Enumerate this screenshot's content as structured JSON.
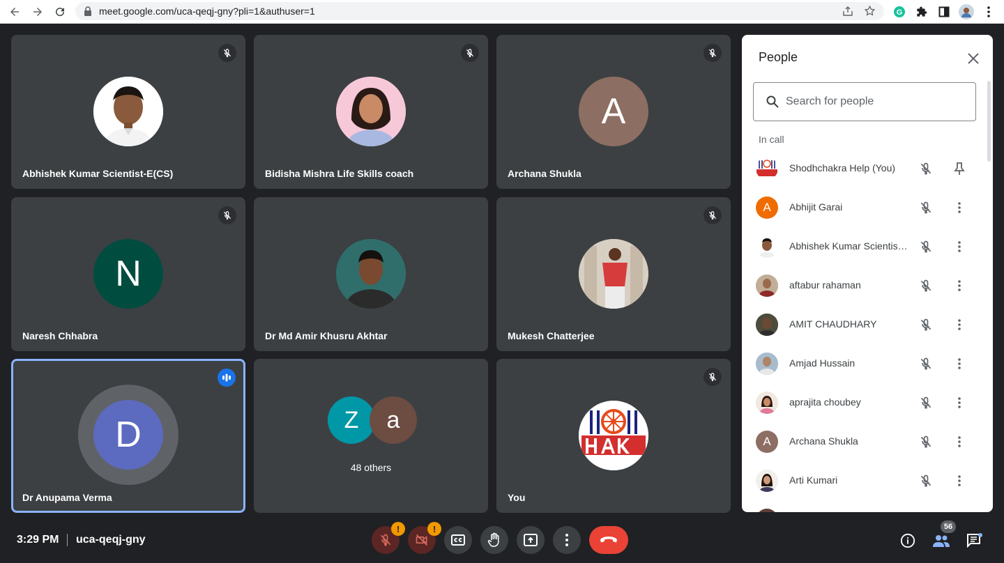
{
  "browser": {
    "url": "meet.google.com/uca-qeqj-gny?pli=1&authuser=1",
    "icons": [
      "back-icon",
      "forward-icon",
      "reload-icon",
      "lock-icon",
      "share-icon",
      "star-icon",
      "grammarly-icon",
      "extensions-icon",
      "sidepanel-icon",
      "profile-icon",
      "menu-icon"
    ]
  },
  "tiles": [
    {
      "name": "Abhishek Kumar Scientist-E(CS)",
      "avatar_type": "photo",
      "muted": true
    },
    {
      "name": "Bidisha Mishra Life Skills coach",
      "avatar_type": "photo",
      "muted": true
    },
    {
      "name": "Archana Shukla",
      "avatar_letter": "A",
      "avatar_color": "#8d6e63",
      "muted": true
    },
    {
      "name": "Naresh Chhabra",
      "avatar_letter": "N",
      "avatar_color": "#004d40",
      "muted": true
    },
    {
      "name": "Dr Md Amir Khusru Akhtar",
      "avatar_type": "photo",
      "muted": false
    },
    {
      "name": "Mukesh Chatterjee",
      "avatar_type": "photo",
      "muted": true
    },
    {
      "name": "Dr Anupama Verma",
      "avatar_letter": "D",
      "avatar_color": "#5c6bc0",
      "speaking": true
    },
    {
      "others_label": "48 others",
      "letters": [
        "Z",
        "a"
      ],
      "colors": [
        "#0097a7",
        "#6d4c41"
      ]
    },
    {
      "name": "You",
      "avatar_type": "logo",
      "muted": true
    }
  ],
  "bottombar": {
    "time": "3:29 PM",
    "meeting_code": "uca-qeqj-gny",
    "warn_mark": "!",
    "people_count": "56",
    "controls": [
      "mic-off-icon",
      "camera-off-icon",
      "captions-icon",
      "raise-hand-icon",
      "present-icon",
      "more-options-icon",
      "leave-call-icon"
    ],
    "right_controls": [
      "info-icon",
      "people-icon",
      "chat-icon"
    ]
  },
  "panel": {
    "title": "People",
    "search_placeholder": "Search for people",
    "section": "In call",
    "participants": [
      {
        "name": "Shodhchakra Help (You)",
        "avatar": "logo",
        "action": "pin-icon"
      },
      {
        "name": "Abhijit Garai",
        "letter": "A",
        "color": "#ef6c00",
        "action": "more-icon"
      },
      {
        "name": "Abhishek Kumar Scientist-E(CS)",
        "avatar": "photo",
        "action": "more-icon"
      },
      {
        "name": "aftabur rahaman",
        "avatar": "photo",
        "action": "more-icon"
      },
      {
        "name": "AMIT CHAUDHARY",
        "avatar": "photo",
        "action": "more-icon"
      },
      {
        "name": "Amjad Hussain",
        "avatar": "photo",
        "action": "more-icon"
      },
      {
        "name": "aprajita choubey",
        "avatar": "photo",
        "action": "more-icon"
      },
      {
        "name": "Archana Shukla",
        "letter": "A",
        "color": "#8d6e63",
        "action": "more-icon"
      },
      {
        "name": "Arti Kumari",
        "avatar": "photo",
        "action": "more-icon"
      }
    ]
  }
}
